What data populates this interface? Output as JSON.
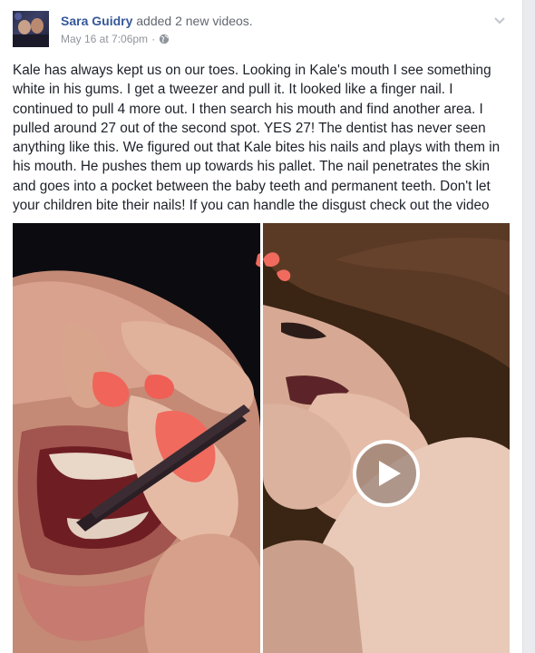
{
  "post": {
    "author": "Sara Guidry",
    "action": "added 2 new videos.",
    "timestamp": "May 16 at 7:06pm",
    "separator": "·",
    "privacy_icon": "globe-icon",
    "menu_icon": "chevron-down-icon",
    "body": "Kale has always kept us on our toes. Looking in Kale's mouth I see something white in his gums. I get a tweezer and pull it. It looked like a finger nail. I continued to pull 4 more out. I then search his mouth and find another area. I pulled around 27 out of the second spot. YES 27! The dentist has never seen anything like this. We figured out that Kale bites his nails and plays with them in his mouth. He pushes them up towards his pallet. The nail penetrates the skin and goes into a pocket between the baby teeth and permanent teeth. Don't let your children bite their nails! If you can handle the disgust check out the video"
  },
  "media": {
    "videos": [
      {
        "kind": "video-thumbnail",
        "has_play_button": false
      },
      {
        "kind": "video-thumbnail",
        "has_play_button": true,
        "play_icon": "play-icon"
      }
    ]
  },
  "colors": {
    "link": "#365899",
    "meta": "#90949c",
    "text": "#1d2129",
    "background": "#e9ebee",
    "nail_polish": "#f0645a"
  }
}
